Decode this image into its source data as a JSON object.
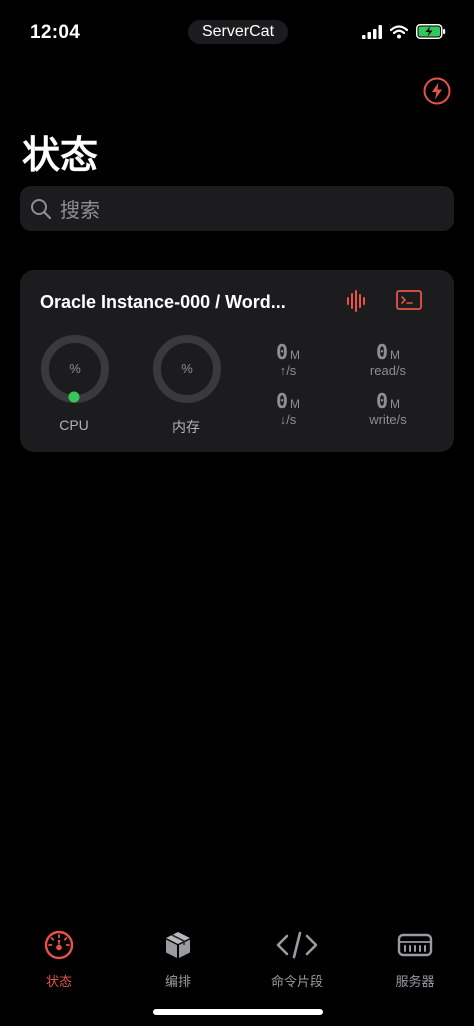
{
  "status_bar": {
    "time": "12:04",
    "app_name": "ServerCat"
  },
  "header": {
    "title": "状态"
  },
  "search": {
    "placeholder": "搜索"
  },
  "server_card": {
    "name": "Oracle Instance-000 / Word...",
    "cpu": {
      "label": "CPU",
      "value_text": "%"
    },
    "memory": {
      "label": "内存",
      "value_text": "%"
    },
    "net_up": {
      "value": "0",
      "unit": "M",
      "label": "↑/s"
    },
    "net_down": {
      "value": "0",
      "unit": "M",
      "label": "↓/s"
    },
    "disk_read": {
      "value": "0",
      "unit": "M",
      "label": "read/s"
    },
    "disk_write": {
      "value": "0",
      "unit": "M",
      "label": "write/s"
    }
  },
  "tab_bar": {
    "tabs": [
      {
        "label": "状态",
        "icon": "gauge-icon",
        "active": true
      },
      {
        "label": "编排",
        "icon": "box-icon",
        "active": false
      },
      {
        "label": "命令片段",
        "icon": "code-icon",
        "active": false
      },
      {
        "label": "服务器",
        "icon": "server-icon",
        "active": false
      }
    ]
  },
  "colors": {
    "accent": "#e5544a",
    "card_bg": "#1c1c1e",
    "muted": "#8e8e93",
    "cpu_dot": "#34c759",
    "tab_inactive": "#9a9a9f"
  }
}
